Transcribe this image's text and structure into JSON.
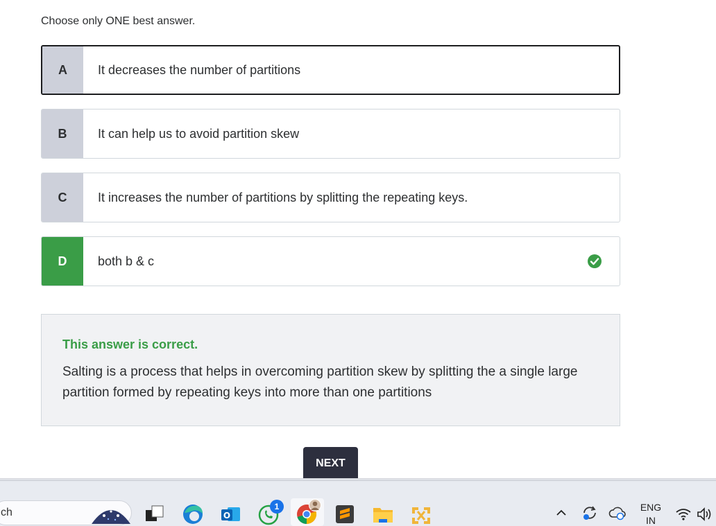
{
  "question": {
    "instruction": "Choose only ONE best answer.",
    "options": [
      {
        "letter": "A",
        "text": "It decreases the number of partitions"
      },
      {
        "letter": "B",
        "text": "It can help us to avoid partition skew"
      },
      {
        "letter": "C",
        "text": "It increases the number of partitions by splitting the repeating keys."
      },
      {
        "letter": "D",
        "text": "both b & c"
      }
    ]
  },
  "feedback": {
    "title": "This answer is correct.",
    "text": "Salting is a process that helps in overcoming partition skew by splitting the a single large partition formed by repeating keys into more than one partitions"
  },
  "next_label": "NEXT",
  "taskbar": {
    "search_text": "ch",
    "whatsapp_badge": "1",
    "language_top": "ENG",
    "language_bottom": "IN"
  },
  "colors": {
    "correct_green": "#3a9d47",
    "letter_bg": "#cdd0da",
    "next_button": "#2d2f3e"
  }
}
